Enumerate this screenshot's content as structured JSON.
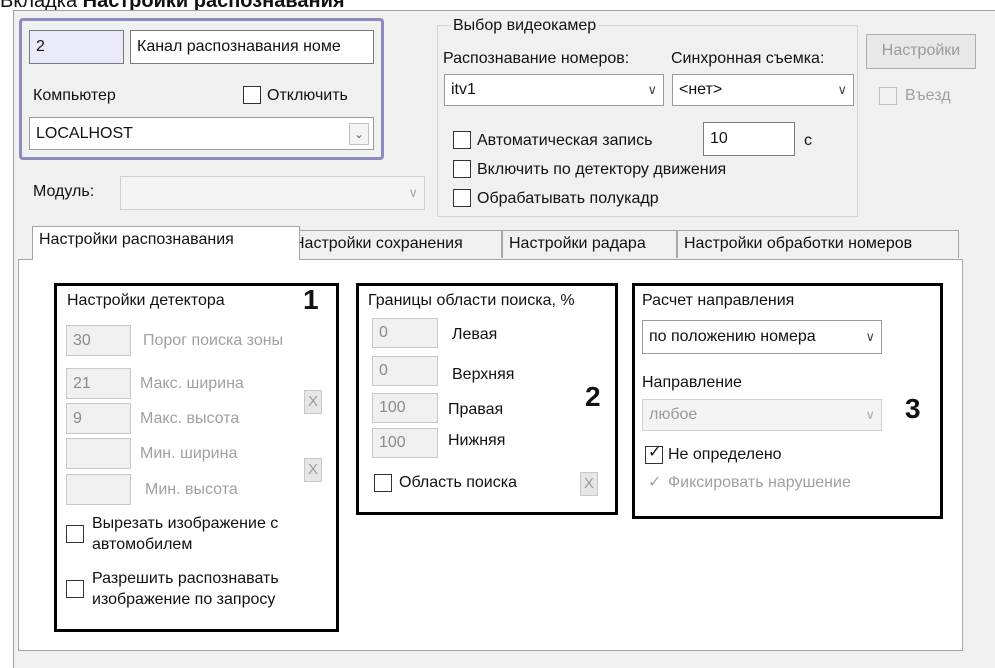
{
  "window": {
    "caption_prefix": "Вкладка ",
    "caption_bold": "Настройки распознавания"
  },
  "top": {
    "id_value": "2",
    "name_value": "Канал распознавания номе",
    "computer_label": "Компьютер",
    "disable_label": "Отключить",
    "computer_value": "LOCALHOST",
    "module_label": "Модуль:",
    "module_value": ""
  },
  "cameras": {
    "group_title": "Выбор видеокамер",
    "recognition_label": "Распознавание номеров:",
    "sync_label": "Синхронная съемка:",
    "recognition_value": "itv1",
    "sync_value": "<нет>",
    "settings_button": "Настройки",
    "entry_label": "Въезд",
    "auto_record_label": "Автоматическая запись",
    "auto_record_value": "10",
    "auto_record_unit": "с",
    "motion_label": "Включить по детектору движения",
    "halfframe_label": "Обрабатывать полукадр"
  },
  "tabs": [
    {
      "label": "Настройки распознавания"
    },
    {
      "label": "Настройки сохранения"
    },
    {
      "label": "Настройки радара"
    },
    {
      "label": "Настройки обработки номеров"
    }
  ],
  "detector": {
    "title": "Настройки детектора",
    "marker": "1",
    "zone_value": "30",
    "zone_label": "Порог поиска зоны",
    "max_width_value": "21",
    "max_width_label": "Макс. ширина",
    "max_height_value": "9",
    "max_height_label": "Макс. высота",
    "min_width_value": "",
    "min_width_label": "Мин. ширина",
    "min_height_value": "",
    "min_height_label": "Мин. высота",
    "x_label": "X",
    "cut_image_line1": "Вырезать изображение с",
    "cut_image_line2": "автомобилем",
    "allow_line1": "Разрешить распознавать",
    "allow_line2": "изображение по запросу"
  },
  "search": {
    "title": "Границы области поиска, %",
    "marker": "2",
    "left_value": "0",
    "left_label": "Левая",
    "top_value": "0",
    "top_label": "Верхняя",
    "right_value": "100",
    "right_label": "Правая",
    "bottom_value": "100",
    "bottom_label": "Нижняя",
    "area_label": "Область поиска",
    "x_label": "X"
  },
  "direction": {
    "calc_title": "Расчет направления",
    "calc_value": "по положению номера",
    "marker": "3",
    "dir_title": "Направление",
    "dir_value": "любое",
    "undefined_label": "Не определено",
    "violation_label": "Фиксировать нарушение"
  }
}
